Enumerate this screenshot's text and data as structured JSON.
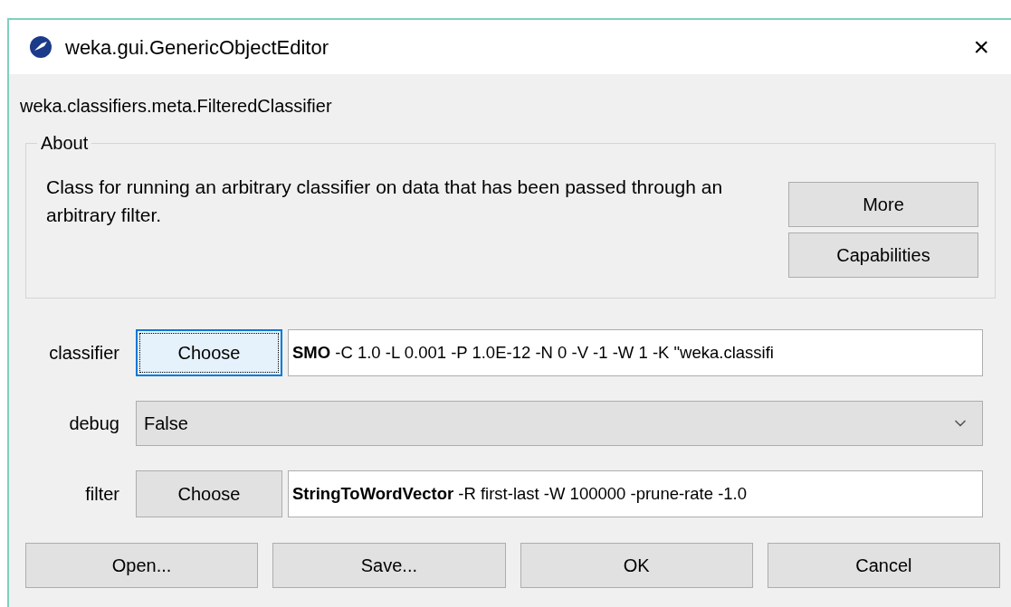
{
  "window": {
    "title": "weka.gui.GenericObjectEditor",
    "close": "×"
  },
  "object_name": "weka.classifiers.meta.FilteredClassifier",
  "about": {
    "legend": "About",
    "text": "Class for running an arbitrary classifier on data that has been passed through an arbitrary filter.",
    "buttons": [
      "More",
      "Capabilities"
    ]
  },
  "properties": [
    {
      "kind": "object",
      "label": "classifier",
      "button": "Choose",
      "focused": true,
      "value": "**SMO** -C 1.0 -L 0.001 -P 1.0E-12 -N 0 -V -1 -W 1 -K \"weka.classifi"
    },
    {
      "kind": "dropdown",
      "label": "debug",
      "value": "False"
    },
    {
      "kind": "object",
      "label": "filter",
      "button": "Choose",
      "focused": false,
      "value": "**StringToWordVector** -R first-last -W 100000 -prune-rate -1.0"
    }
  ],
  "buttons": [
    "Open...",
    "Save...",
    "OK",
    "Cancel"
  ]
}
